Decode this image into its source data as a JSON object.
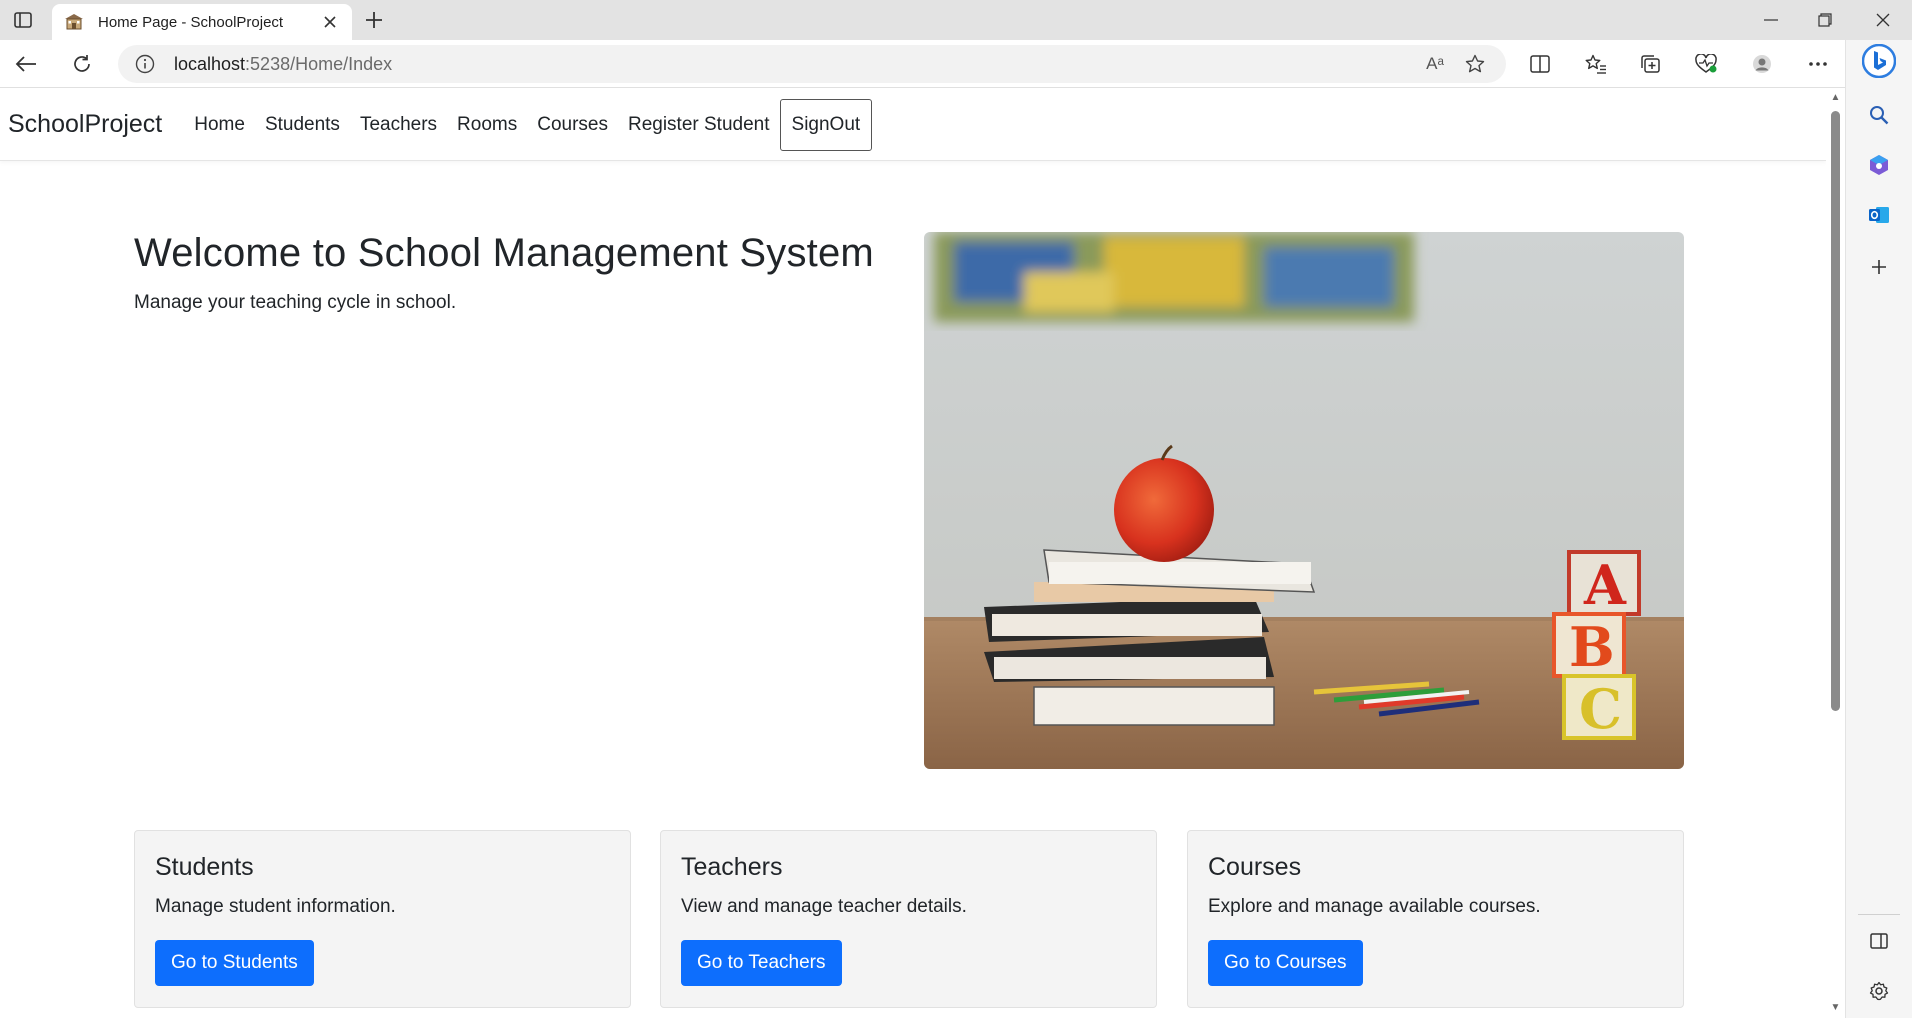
{
  "browser": {
    "tab_title": "Home Page - SchoolProject",
    "url_host": "localhost",
    "url_rest": ":5238/Home/Index",
    "read_aloud_glyph": "Aᵃ"
  },
  "navbar": {
    "brand": "SchoolProject",
    "links": [
      "Home",
      "Students",
      "Teachers",
      "Rooms",
      "Courses",
      "Register Student"
    ],
    "signout": "SignOut"
  },
  "hero": {
    "title": "Welcome to School Management System",
    "subtitle": "Manage your teaching cycle in school."
  },
  "cards": [
    {
      "title": "Students",
      "text": "Manage student information.",
      "button": "Go to Students"
    },
    {
      "title": "Teachers",
      "text": "View and manage teacher details.",
      "button": "Go to Teachers"
    },
    {
      "title": "Courses",
      "text": "Explore and manage available courses.",
      "button": "Go to Courses"
    }
  ],
  "colors": {
    "primary_button": "#0d6efd",
    "card_background": "#f4f4f4"
  }
}
